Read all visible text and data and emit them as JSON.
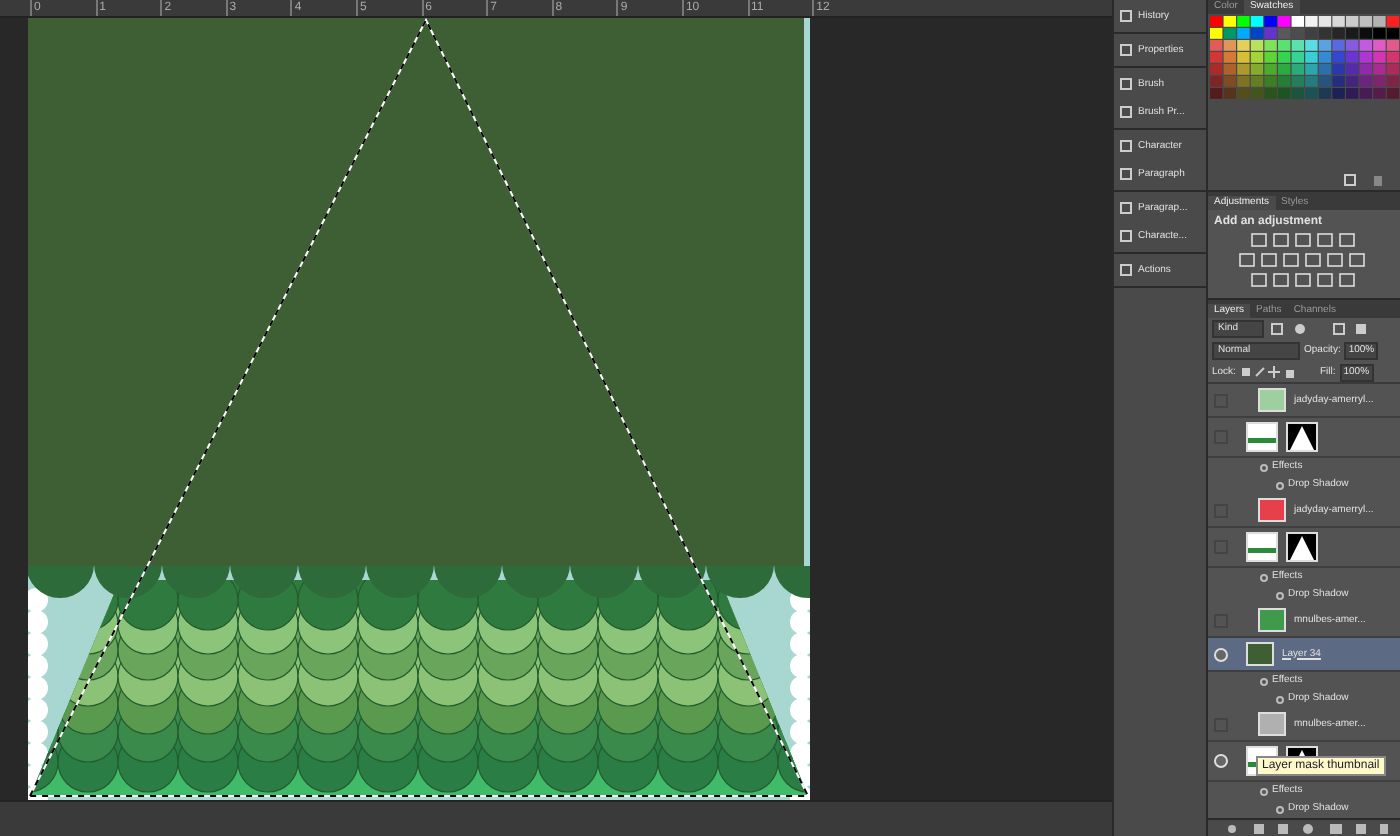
{
  "ruler": {
    "ticks": [
      "0",
      "1",
      "2",
      "3",
      "4",
      "5",
      "6",
      "7",
      "8",
      "9",
      "10",
      "11",
      "12"
    ]
  },
  "dock": {
    "groups": [
      {
        "items": [
          {
            "label": "History"
          }
        ]
      },
      {
        "items": [
          {
            "label": "Properties"
          }
        ]
      },
      {
        "items": [
          {
            "label": "Brush"
          },
          {
            "label": "Brush Pr..."
          }
        ]
      },
      {
        "items": [
          {
            "label": "Character"
          },
          {
            "label": "Paragraph"
          }
        ]
      },
      {
        "items": [
          {
            "label": "Paragrap..."
          },
          {
            "label": "Characte..."
          }
        ]
      },
      {
        "items": [
          {
            "label": "Actions"
          }
        ]
      }
    ]
  },
  "swatches_panel": {
    "tabs": [
      {
        "label": "Color",
        "selected": false
      },
      {
        "label": "Swatches",
        "selected": true
      }
    ]
  },
  "adjustments_panel": {
    "tabs": [
      {
        "label": "Adjustments",
        "selected": true
      },
      {
        "label": "Styles",
        "selected": false
      }
    ],
    "heading": "Add an adjustment"
  },
  "layers_panel": {
    "tabs": [
      {
        "label": "Layers",
        "selected": true
      },
      {
        "label": "Paths",
        "selected": false
      },
      {
        "label": "Channels",
        "selected": false
      }
    ],
    "filter": "Kind",
    "blend_mode": "Normal",
    "opacity_label": "Opacity:",
    "opacity": "100%",
    "lock_label": "Lock:",
    "fill_label": "Fill:",
    "fill": "100%",
    "rows": [
      {
        "kind": "layer",
        "name": "jadyday-amerryl...",
        "color": "#9fcf9f",
        "visible": false,
        "selected": false
      },
      {
        "kind": "masked",
        "visible": false,
        "selected": false
      },
      {
        "kind": "effects",
        "label": "Effects"
      },
      {
        "kind": "effect",
        "label": "Drop Shadow"
      },
      {
        "kind": "layer",
        "name": "jadyday-amerryl...",
        "color": "#e8404a",
        "visible": false,
        "selected": false
      },
      {
        "kind": "masked",
        "visible": false,
        "selected": false
      },
      {
        "kind": "effects",
        "label": "Effects"
      },
      {
        "kind": "effect",
        "label": "Drop Shadow"
      },
      {
        "kind": "layer",
        "name": "mnulbes-amer...",
        "color": "#3f9a4c",
        "visible": false,
        "selected": false
      },
      {
        "kind": "named",
        "name": "Layer 34",
        "color": "#3e5e33",
        "visible": true,
        "selected": true
      },
      {
        "kind": "effects",
        "label": "Effects"
      },
      {
        "kind": "effect",
        "label": "Drop Shadow"
      },
      {
        "kind": "layer",
        "name": "mnulbes-amer...",
        "color": "#b0b0b0",
        "visible": false,
        "selected": false
      },
      {
        "kind": "masked",
        "visible": true,
        "selected": false
      },
      {
        "kind": "effects",
        "label": "Effects"
      },
      {
        "kind": "effect",
        "label": "Drop Shadow"
      }
    ],
    "tooltip": "Layer mask thumbnail"
  }
}
